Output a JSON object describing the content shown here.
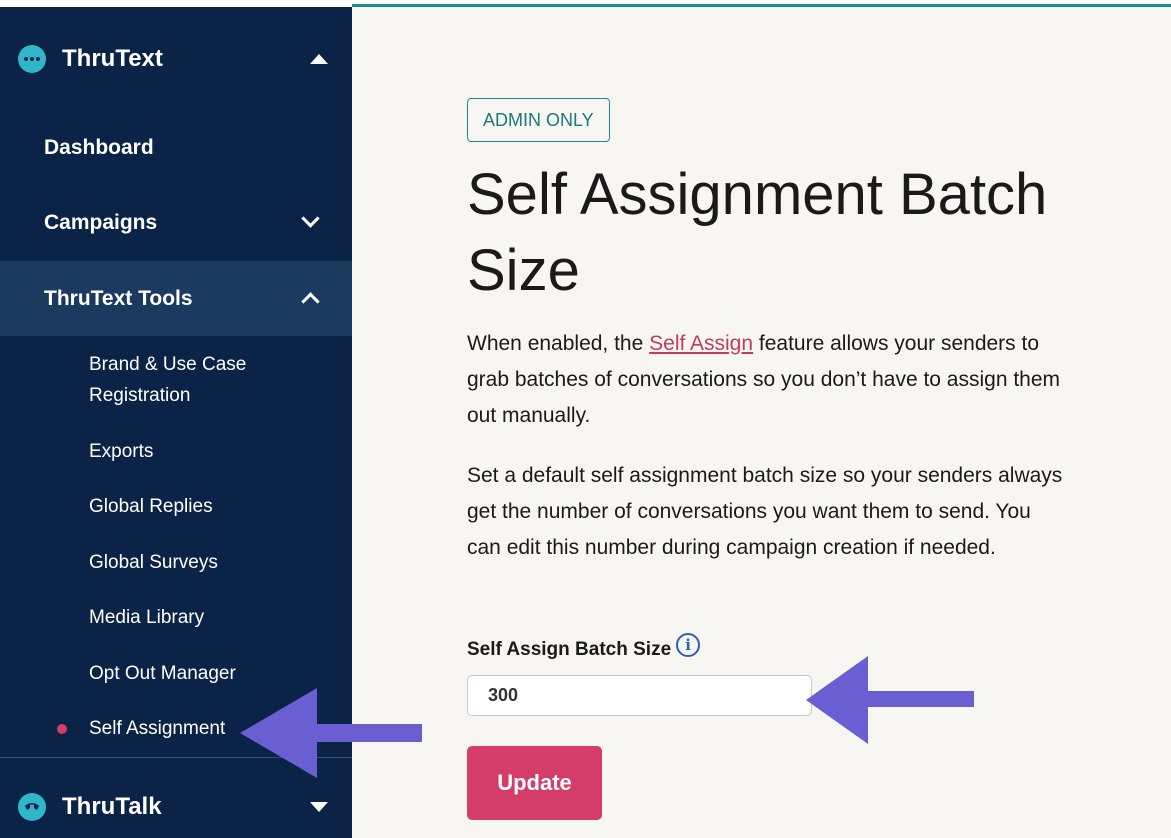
{
  "sidebar": {
    "brands": {
      "thrutext": "ThruText",
      "thrutalk": "ThruTalk"
    },
    "nav": {
      "dashboard": "Dashboard",
      "campaigns": "Campaigns",
      "tools": "ThruText Tools"
    },
    "sub_items": [
      "Brand & Use Case",
      "Registration",
      "Exports",
      "Global Replies",
      "Global Surveys",
      "Media Library",
      "Opt Out Manager",
      "Self Assignment"
    ]
  },
  "main": {
    "badge": "ADMIN ONLY",
    "title_line1": "Self Assignment Batch",
    "title_line2": "Size",
    "p1_before": "When enabled, the ",
    "p1_link": "Self Assign",
    "p1_after": " feature allows your senders to grab batches of conversations so you don’t have to assign them out manually.",
    "p2": "Set a default self assignment batch size so your senders always get the number of conversations you want them to send. You can edit this number during campaign creation if needed.",
    "field_label": "Self Assign Batch Size",
    "field_value": "300",
    "update_label": "Update"
  },
  "colors": {
    "sidebar_bg": "#0a2346",
    "active_bg": "#1b3a5f",
    "accent_pink": "#d33d68",
    "teal": "#1b8c8a",
    "arrow": "#6a5fd2"
  },
  "icons": [
    "chat-dots-icon",
    "phone-icon",
    "info-icon",
    "chevron-down-icon",
    "chevron-up-icon",
    "caret-up-icon",
    "caret-down-icon",
    "arrow-left-icon"
  ]
}
